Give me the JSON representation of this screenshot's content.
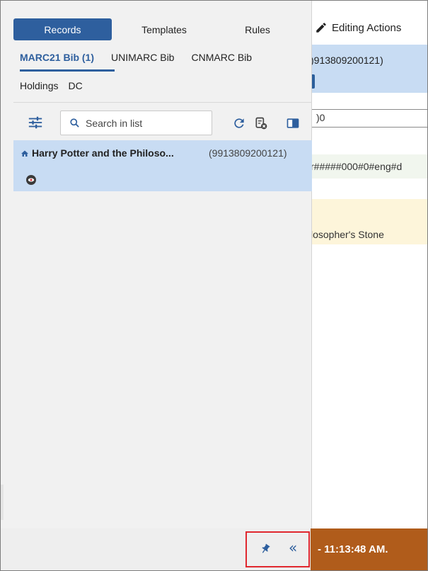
{
  "top_tabs": [
    "Records",
    "Templates",
    "Rules"
  ],
  "editing_actions": "Editing Actions",
  "record_types_row1": [
    "MARC21 Bib (1)",
    "UNIMARC Bib",
    "CNMARC Bib"
  ],
  "record_types_row2": [
    "Holdings",
    "DC"
  ],
  "search": {
    "placeholder": "Search in list"
  },
  "record": {
    "title": "Harry Potter and the Philoso...",
    "id": "(9913809200121)"
  },
  "background": {
    "record_id_partial": ")913809200121)",
    "field_value": ")0",
    "control_field": "r#####000#0#eng#d",
    "title_partial": "losopher's Stone",
    "status_time": "- 11:13:48 AM."
  },
  "colors": {
    "accent": "#2e5f9e",
    "selected_row": "#c8dcf3",
    "status_bar": "#b05c1b",
    "highlight": "#e0282f"
  },
  "icons": [
    "filter-icon",
    "search-icon",
    "refresh-icon",
    "clear-list-icon",
    "split-view-icon",
    "home-icon",
    "preview-eye-icon",
    "pin-icon",
    "collapse-icon",
    "pencil-icon"
  ]
}
